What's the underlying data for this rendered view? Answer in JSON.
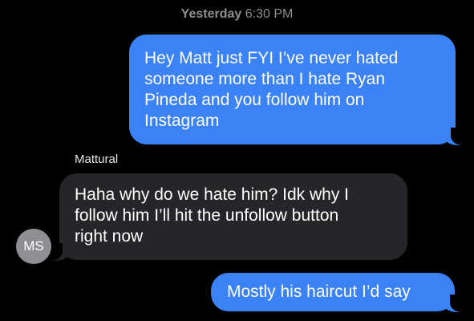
{
  "header": {
    "day": "Yesterday",
    "time": "6:30 PM"
  },
  "messages": [
    {
      "direction": "outgoing",
      "lines": [
        "Hey Matt just FYI I’ve never hated",
        "someone more than I hate Ryan",
        "Pineda and you follow him on",
        "Instagram"
      ]
    },
    {
      "direction": "incoming",
      "sender": "Mattural",
      "lines": [
        "Haha why do we hate him? Idk why I",
        "follow him I’ll hit the unfollow button",
        "right now"
      ]
    },
    {
      "direction": "outgoing",
      "lines": [
        "Mostly his haircut I’d say"
      ]
    }
  ],
  "contact": {
    "initials": "MS"
  },
  "colors": {
    "background": "#000000",
    "outgoing_bubble": "#3b82f6",
    "incoming_bubble": "#262629",
    "avatar": "#8e8e93",
    "timestamp": "#8e8e93"
  }
}
